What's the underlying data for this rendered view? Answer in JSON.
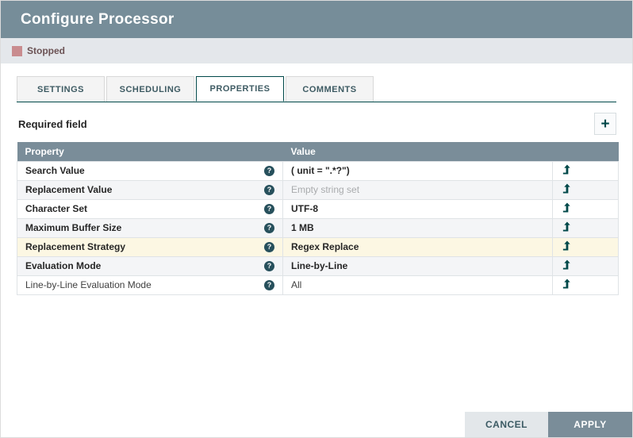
{
  "dialog": {
    "title": "Configure Processor"
  },
  "status": {
    "label": "Stopped"
  },
  "tabs": [
    {
      "label": "SETTINGS",
      "active": false
    },
    {
      "label": "SCHEDULING",
      "active": false
    },
    {
      "label": "PROPERTIES",
      "active": true
    },
    {
      "label": "COMMENTS",
      "active": false
    }
  ],
  "toolbar": {
    "required_field_label": "Required field"
  },
  "icons": {
    "add": "+",
    "help": "?"
  },
  "properties_table": {
    "columns": {
      "property": "Property",
      "value": "Value"
    },
    "rows": [
      {
        "property": "Search Value",
        "value": "( unit = \".*?\")",
        "state": "set",
        "highlight": false
      },
      {
        "property": "Replacement Value",
        "value": "Empty string set",
        "state": "empty",
        "highlight": false
      },
      {
        "property": "Character Set",
        "value": "UTF-8",
        "state": "set",
        "highlight": false
      },
      {
        "property": "Maximum Buffer Size",
        "value": "1 MB",
        "state": "set",
        "highlight": false
      },
      {
        "property": "Replacement Strategy",
        "value": "Regex Replace",
        "state": "set",
        "highlight": true
      },
      {
        "property": "Evaluation Mode",
        "value": "Line-by-Line",
        "state": "set",
        "highlight": false
      },
      {
        "property": "Line-by-Line Evaluation Mode",
        "value": "All",
        "state": "set",
        "highlight": false
      }
    ]
  },
  "footer": {
    "cancel_label": "CANCEL",
    "apply_label": "APPLY"
  },
  "colors": {
    "titlebar_bg": "#768d99",
    "status_strip_bg": "#e4e7eb",
    "stopped_square": "#c98c8f",
    "stopped_text": "#6b5254",
    "accent_teal": "#004849",
    "table_header_bg": "#7a8d99",
    "row_alt_bg": "#f4f5f7",
    "row_highlight_bg": "#fcf7e3",
    "empty_value_text": "#a9abad",
    "cancel_bg": "#e3e7ea",
    "apply_bg": "#7a8d99"
  }
}
